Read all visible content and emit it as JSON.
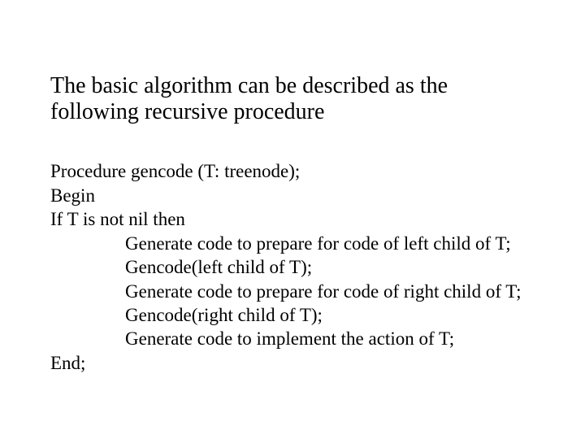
{
  "title": "The basic algorithm can be described as the following recursive procedure",
  "lines": {
    "l0": "Procedure gencode (T: treenode);",
    "l1": "Begin",
    "l2": "If T is not nil then",
    "l3": "Generate code to prepare for code of left child of T;",
    "l4": "Gencode(left child of T);",
    "l5": "Generate code to prepare for code of right child of T;",
    "l6": "Gencode(right child of T);",
    "l7": "Generate code to implement the action of T;",
    "l8": "End;"
  }
}
